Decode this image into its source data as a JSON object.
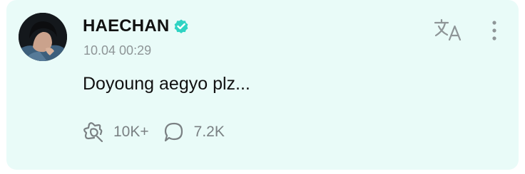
{
  "post": {
    "author": "HAECHAN",
    "verified": true,
    "timestamp": "10.04 00:29",
    "text": "Doyoung aegyo plz..."
  },
  "stats": {
    "likes": "10K+",
    "comments": "7.2K"
  },
  "icons": {
    "verified": "verified-badge-icon",
    "translate": "translate-icon",
    "more": "more-vertical-icon",
    "like": "like-icon",
    "comment": "comment-icon"
  },
  "colors": {
    "card_background": "#e9fbf8",
    "verified_badge": "#2fd3c3",
    "muted_text": "#8e9597",
    "primary_text": "#111111"
  }
}
